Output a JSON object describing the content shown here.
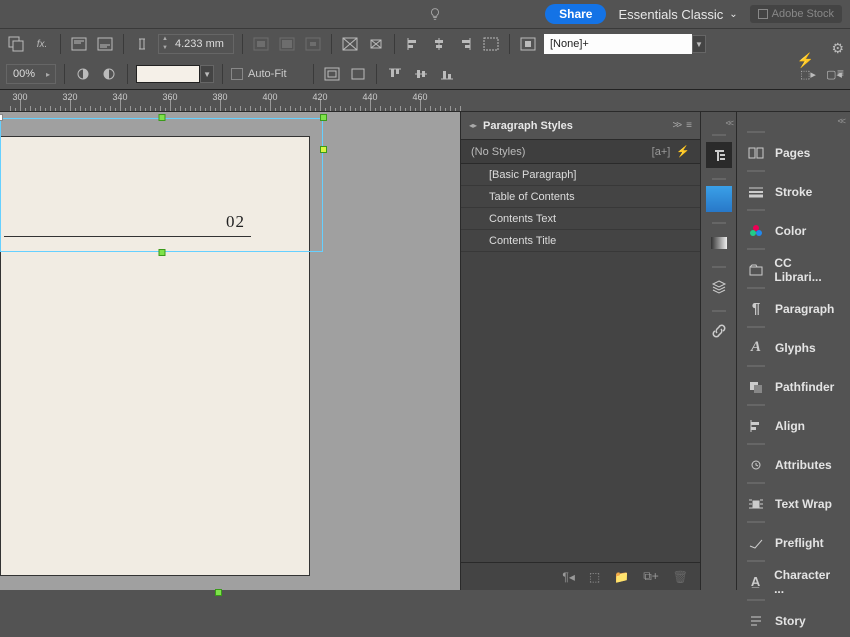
{
  "menubar": {
    "share": "Share",
    "workspace": "Essentials Classic",
    "stock_placeholder": "Adobe Stock"
  },
  "control": {
    "height_value": "4.233 mm",
    "autofit_label": "Auto-Fit",
    "zoom": "00%",
    "para_style": "[None]+"
  },
  "ruler": {
    "ticks": [
      300,
      320,
      340,
      360,
      380,
      400,
      420,
      440,
      460
    ]
  },
  "canvas": {
    "page_number": "02"
  },
  "paragraph_panel": {
    "title": "Paragraph Styles",
    "group_label": "(No Styles)",
    "styles": [
      "[Basic Paragraph]",
      "Table of Contents",
      "Contents Text",
      "Contents Title"
    ]
  },
  "right_panels": [
    "Pages",
    "Stroke",
    "Color",
    "CC Librari...",
    "Paragraph",
    "Glyphs",
    "Pathfinder",
    "Align",
    "Attributes",
    "Text Wrap",
    "Preflight",
    "Character ...",
    "Story"
  ]
}
